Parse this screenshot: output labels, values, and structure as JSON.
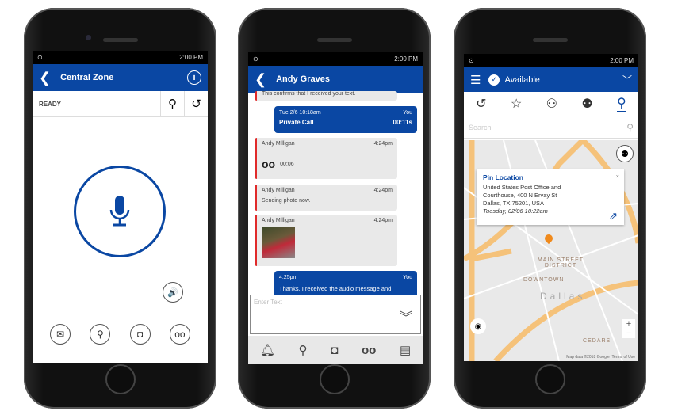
{
  "status_time": "2:00 PM",
  "phone1": {
    "title": "Central Zone",
    "status": "READY"
  },
  "phone2": {
    "title": "Andy Graves",
    "messages": [
      {
        "text": "This confirms that I received your text."
      },
      {
        "sender": "You",
        "time": "Tue 2/6 10:18am",
        "label": "Private Call",
        "duration": "00:11s"
      },
      {
        "sender": "Andy Milligan",
        "time": "4:24pm",
        "audio_duration": "00:06"
      },
      {
        "sender": "Andy Milligan",
        "time": "4:24pm",
        "text": "Sending photo now."
      },
      {
        "sender": "Andy Milligan",
        "time": "4:24pm"
      },
      {
        "sender": "You",
        "time": "4:25pm",
        "text": "Thanks. I received the audio message and"
      }
    ],
    "input_placeholder": "Enter Text"
  },
  "phone3": {
    "status": "Available",
    "search_placeholder": "Search",
    "popup": {
      "title": "Pin Location",
      "line1": "United States Post Office and",
      "line2": "Courthouse, 400 N Ervay St",
      "line3": "Dallas, TX 75201, USA",
      "timestamp": "Tuesday, 02/06 10:22am"
    },
    "map_labels": {
      "district": "MAIN STREET DISTRICT",
      "downtown": "DOWNTOWN",
      "city": "Dallas",
      "cedars": "CEDARS"
    },
    "attribution": "Map data ©2018 Google",
    "terms": "Terms of Use",
    "zoom_in": "+",
    "zoom_out": "−"
  },
  "colors": {
    "brand": "#0a47a3",
    "alert": "#e02a2a",
    "pin": "#f08a1c"
  }
}
